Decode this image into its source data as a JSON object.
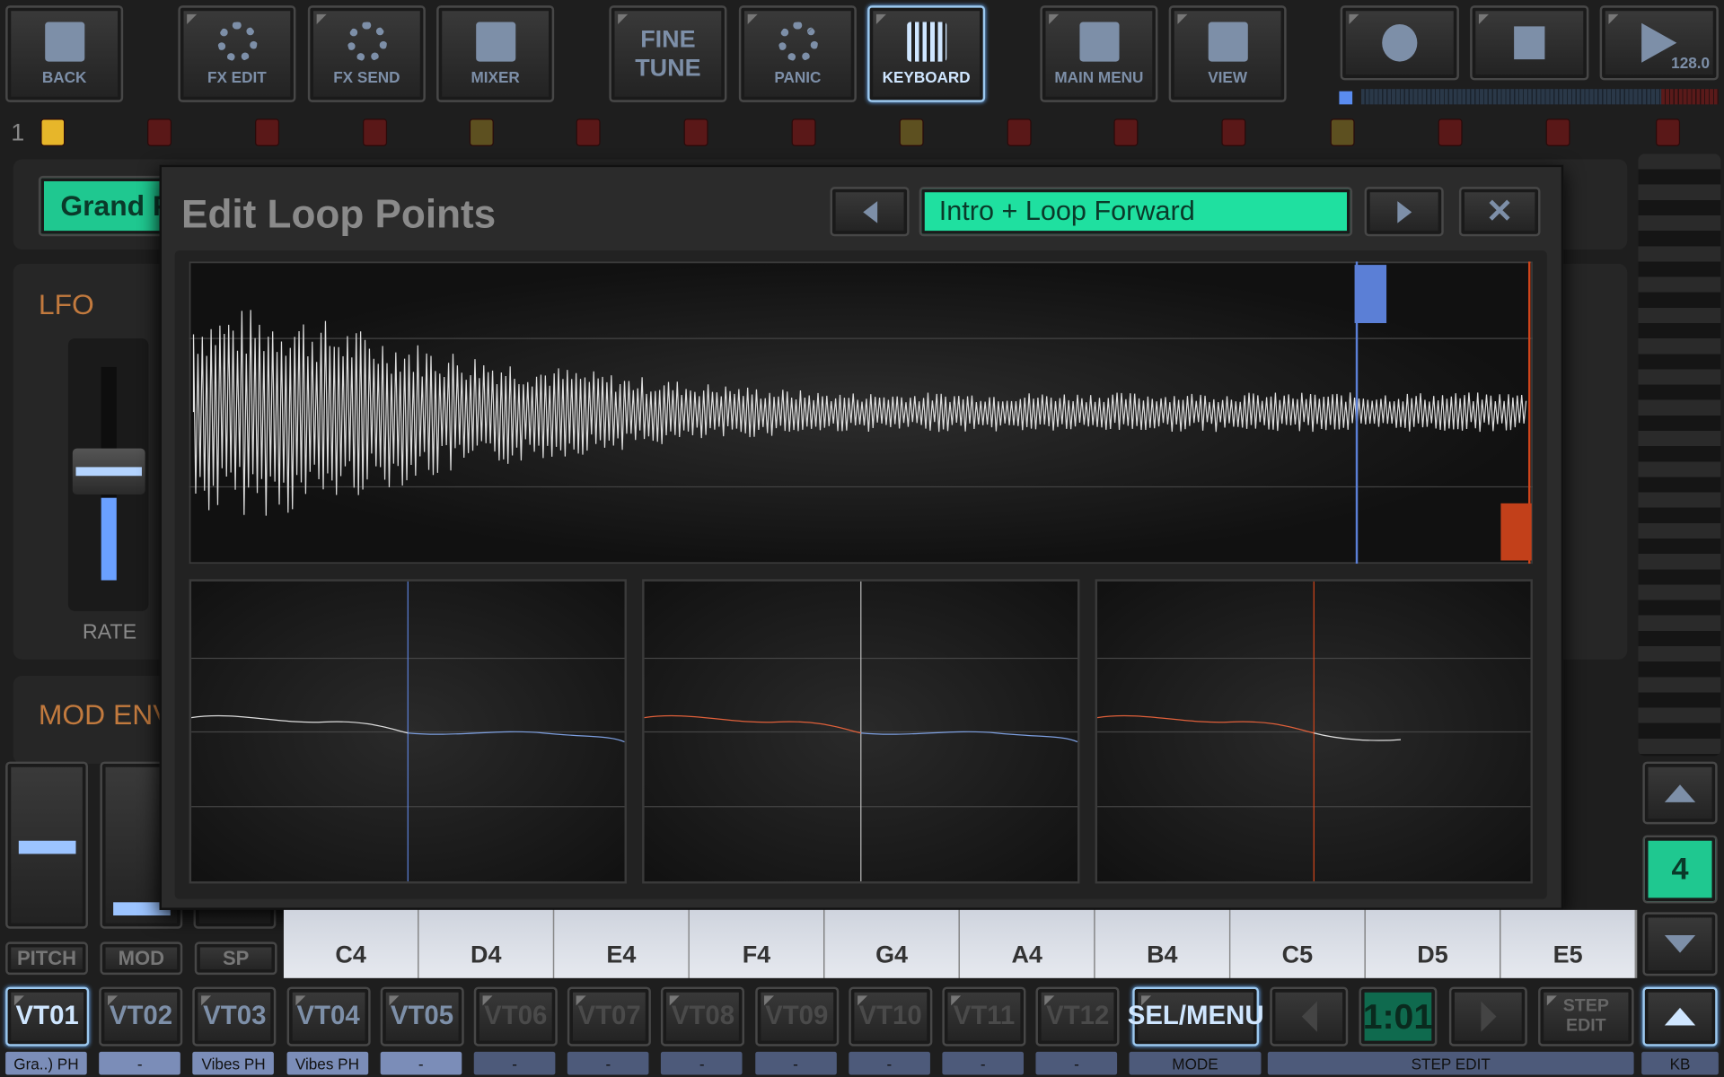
{
  "toolbar": {
    "buttons": [
      {
        "id": "back",
        "label": "BACK",
        "icon": "undo-arrow-icon"
      },
      {
        "id": "fx-edit",
        "label": "FX EDIT",
        "icon": "fx-ring-icon"
      },
      {
        "id": "fx-send",
        "label": "FX SEND",
        "icon": "fx-send-ring-icon"
      },
      {
        "id": "mixer",
        "label": "MIXER",
        "icon": "mixer-sliders-icon"
      },
      {
        "id": "fine-tune",
        "label": "FINE TUNE"
      },
      {
        "id": "panic",
        "label": "PANIC",
        "icon": "panic-icon"
      },
      {
        "id": "keyboard",
        "label": "KEYBOARD",
        "icon": "keyboard-icon",
        "selected": true
      },
      {
        "id": "main-menu",
        "label": "MAIN MENU",
        "icon": "drawer-icon"
      },
      {
        "id": "view",
        "label": "VIEW",
        "icon": "grid-icon"
      }
    ],
    "transport": {
      "record": "record-icon",
      "stop": "stop-icon",
      "play": "play-icon",
      "tempo": "128.0"
    }
  },
  "tracks": {
    "number": "1",
    "states": [
      "active",
      "muted",
      "muted",
      "muted",
      "dim",
      "muted",
      "muted",
      "muted",
      "dim",
      "muted",
      "muted",
      "muted",
      "dim",
      "muted",
      "muted",
      "muted"
    ]
  },
  "instrument": {
    "preset_label": "Grand P"
  },
  "lfo": {
    "title": "LFO",
    "rate_label": "RATE",
    "rate_level": 0.55
  },
  "mod_env": {
    "title": "MOD ENV"
  },
  "dialog": {
    "title": "Edit Loop Points",
    "mode": "Intro + Loop Forward",
    "prev": "chevron-left-icon",
    "next": "chevron-right-icon",
    "close": "close-icon"
  },
  "colors": {
    "accent_green": "#1fe0a0",
    "loop_start": "#5b7fd6",
    "loop_end": "#d0451b",
    "selected_border": "#9cc9f0"
  },
  "wheels": {
    "labels": [
      "PITCH",
      "MOD",
      "SP"
    ]
  },
  "keyboard": {
    "keys": [
      "C4",
      "D4",
      "E4",
      "F4",
      "G4",
      "A4",
      "B4",
      "C5",
      "D5",
      "E5"
    ],
    "octave": "4"
  },
  "voices": {
    "buttons": [
      "VT01",
      "VT02",
      "VT03",
      "VT04",
      "VT05",
      "VT06",
      "VT07",
      "VT08",
      "VT09",
      "VT10",
      "VT11",
      "VT12"
    ],
    "tags": [
      "Gra..) PH",
      "-",
      "Vibes PH",
      "Vibes PH",
      "-",
      "-",
      "-",
      "-",
      "-",
      "-",
      "-",
      "-"
    ]
  },
  "bottom": {
    "sel_menu": "SEL/MENU",
    "mode": "MODE",
    "position": "1:01",
    "step_edit": "STEP EDIT",
    "step_edit_tag": "STEP EDIT",
    "kb": "KB"
  }
}
